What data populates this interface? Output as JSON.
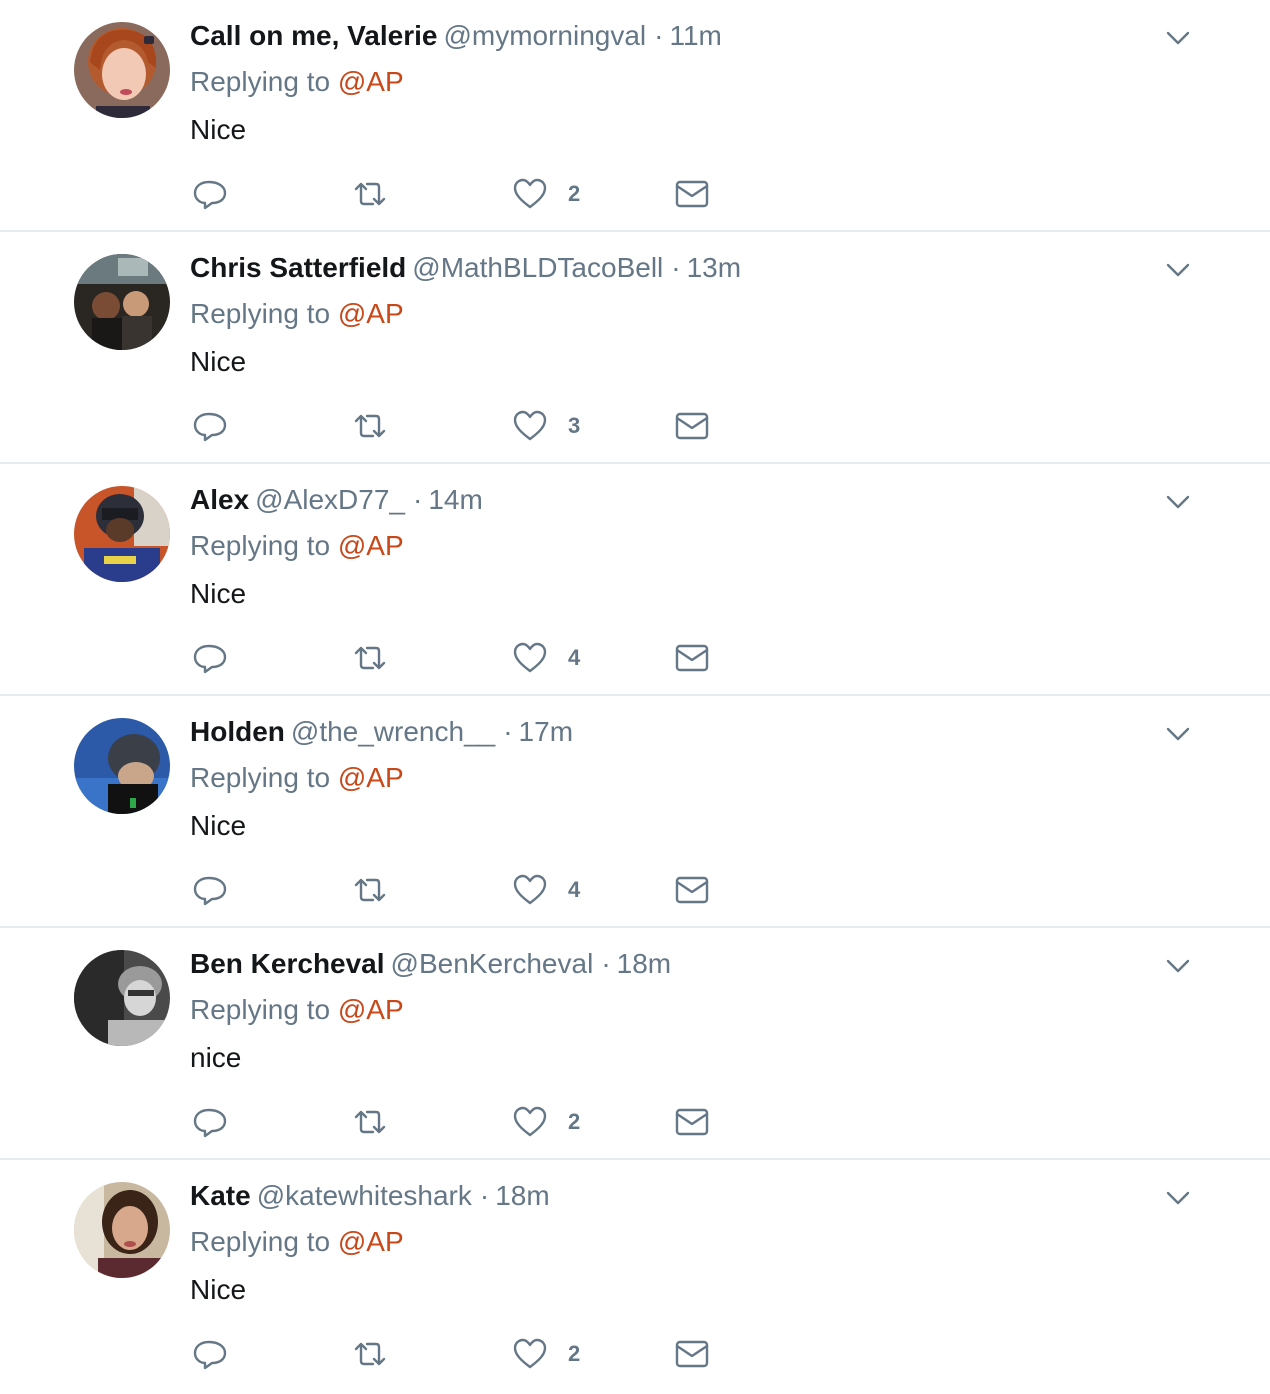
{
  "tweets": [
    {
      "name": "Call on me, Valerie",
      "handle": "@mymorningval",
      "separator": "·",
      "time": "11m",
      "replying_prefix": "Replying to",
      "replying_mention": "@AP",
      "text": "Nice",
      "likes": "2"
    },
    {
      "name": "Chris Satterfield",
      "handle": "@MathBLDTacoBell",
      "separator": "·",
      "time": "13m",
      "replying_prefix": "Replying to",
      "replying_mention": "@AP",
      "text": "Nice",
      "likes": "3"
    },
    {
      "name": "Alex",
      "handle": "@AlexD77_",
      "separator": "·",
      "time": "14m",
      "replying_prefix": "Replying to",
      "replying_mention": "@AP",
      "text": "Nice",
      "likes": "4"
    },
    {
      "name": "Holden",
      "handle": "@the_wrench__",
      "separator": "·",
      "time": "17m",
      "replying_prefix": "Replying to",
      "replying_mention": "@AP",
      "text": "Nice",
      "likes": "4"
    },
    {
      "name": "Ben Kercheval",
      "handle": "@BenKercheval",
      "separator": "·",
      "time": "18m",
      "replying_prefix": "Replying to",
      "replying_mention": "@AP",
      "text": "nice",
      "likes": "2"
    },
    {
      "name": "Kate",
      "handle": "@katewhiteshark",
      "separator": "·",
      "time": "18m",
      "replying_prefix": "Replying to",
      "replying_mention": "@AP",
      "text": "Nice",
      "likes": "2"
    }
  ],
  "icons": {
    "reply": "reply-icon",
    "retweet": "retweet-icon",
    "like": "heart-icon",
    "dm": "envelope-icon",
    "caret": "chevron-down-icon"
  },
  "colors": {
    "name": "#14171a",
    "secondary": "#657786",
    "mention": "#c8481a",
    "divider": "#e6ecf0"
  }
}
